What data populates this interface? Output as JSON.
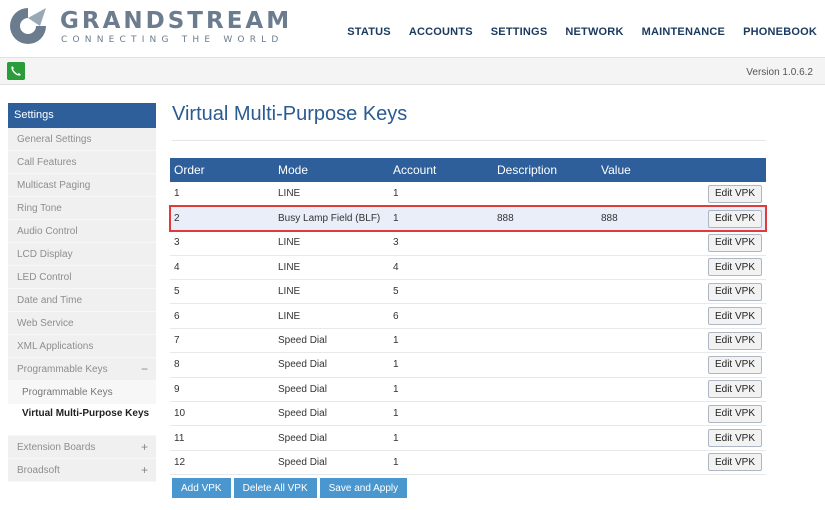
{
  "brand": {
    "name": "GRANDSTREAM",
    "tagline": "CONNECTING THE WORLD",
    "color": "#6b7c8f"
  },
  "nav": [
    "STATUS",
    "ACCOUNTS",
    "SETTINGS",
    "NETWORK",
    "MAINTENANCE",
    "PHONEBOOK"
  ],
  "version": "Version 1.0.6.2",
  "sidebar": {
    "header": "Settings",
    "items": [
      {
        "label": "General Settings"
      },
      {
        "label": "Call Features"
      },
      {
        "label": "Multicast Paging"
      },
      {
        "label": "Ring Tone"
      },
      {
        "label": "Audio Control"
      },
      {
        "label": "LCD Display"
      },
      {
        "label": "LED Control"
      },
      {
        "label": "Date and Time"
      },
      {
        "label": "Web Service"
      },
      {
        "label": "XML Applications"
      },
      {
        "label": "Programmable Keys",
        "sign": "−"
      },
      {
        "label": "Programmable Keys"
      },
      {
        "label": "Virtual Multi-Purpose Keys"
      },
      {
        "label": "Extension Boards",
        "sign": "+"
      },
      {
        "label": "Broadsoft",
        "sign": "+"
      }
    ]
  },
  "page_title": "Virtual Multi-Purpose Keys",
  "table": {
    "headers": [
      "Order",
      "Mode",
      "Account",
      "Description",
      "Value"
    ],
    "edit_label": "Edit VPK",
    "rows": [
      {
        "order": "1",
        "mode": "LINE",
        "account": "1",
        "description": "",
        "value": ""
      },
      {
        "order": "2",
        "mode": "Busy Lamp Field (BLF)",
        "account": "1",
        "description": "888",
        "value": "888"
      },
      {
        "order": "3",
        "mode": "LINE",
        "account": "3",
        "description": "",
        "value": ""
      },
      {
        "order": "4",
        "mode": "LINE",
        "account": "4",
        "description": "",
        "value": ""
      },
      {
        "order": "5",
        "mode": "LINE",
        "account": "5",
        "description": "",
        "value": ""
      },
      {
        "order": "6",
        "mode": "LINE",
        "account": "6",
        "description": "",
        "value": ""
      },
      {
        "order": "7",
        "mode": "Speed Dial",
        "account": "1",
        "description": "",
        "value": ""
      },
      {
        "order": "8",
        "mode": "Speed Dial",
        "account": "1",
        "description": "",
        "value": ""
      },
      {
        "order": "9",
        "mode": "Speed Dial",
        "account": "1",
        "description": "",
        "value": ""
      },
      {
        "order": "10",
        "mode": "Speed Dial",
        "account": "1",
        "description": "",
        "value": ""
      },
      {
        "order": "11",
        "mode": "Speed Dial",
        "account": "1",
        "description": "",
        "value": ""
      },
      {
        "order": "12",
        "mode": "Speed Dial",
        "account": "1",
        "description": "",
        "value": ""
      }
    ]
  },
  "actions": {
    "add": "Add VPK",
    "delete_all": "Delete All VPK",
    "save": "Save and Apply"
  },
  "colors": {
    "nav_text": "#1b3a60",
    "table_header": "#2e5f9a",
    "button": "#4a97cf",
    "highlight_border": "#e03a3a"
  },
  "icons": {
    "logo": "grandstream-logo-icon",
    "phone": "phone-icon"
  }
}
